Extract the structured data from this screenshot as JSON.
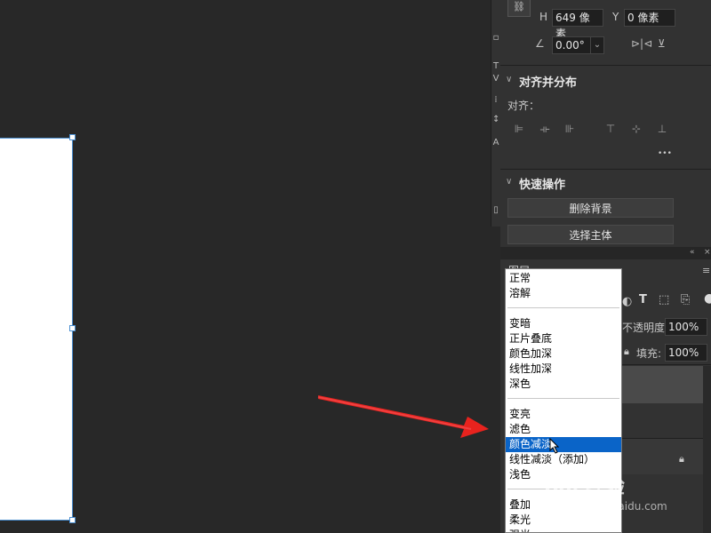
{
  "transform": {
    "h_label": "H",
    "h_value": "649 像素",
    "y_label": "Y",
    "y_value": "0 像素",
    "angle_value": "0.00°"
  },
  "align_section": {
    "title": "对齐并分布",
    "align_label": "对齐：",
    "more": "•••"
  },
  "quick_actions": {
    "title": "快速操作",
    "remove_bg": "删除背景",
    "select_subject": "选择主体"
  },
  "layers": {
    "tab_label": "图层",
    "opacity_label": "不透明度:",
    "opacity_value": "100%",
    "fill_label": "填充:",
    "fill_value": "100%",
    "text_icon_glyph": "T"
  },
  "blend_modes": {
    "group1": [
      "正常",
      "溶解"
    ],
    "group2": [
      "变暗",
      "正片叠底",
      "颜色加深",
      "线性加深",
      "深色"
    ],
    "group3": [
      "变亮",
      "滤色",
      "颜色减淡",
      "线性减淡（添加）",
      "浅色"
    ],
    "group4": [
      "叠加",
      "柔光",
      "强光"
    ],
    "selected": "颜色减淡"
  },
  "watermark": {
    "brand": "Bai 经验",
    "url": "jingyan.baidu.com"
  },
  "colors": {
    "canvas_bg": "#282828",
    "panel_bg": "#323232",
    "selection_blue": "#0a64c8",
    "arrow_red": "#e8231e"
  }
}
